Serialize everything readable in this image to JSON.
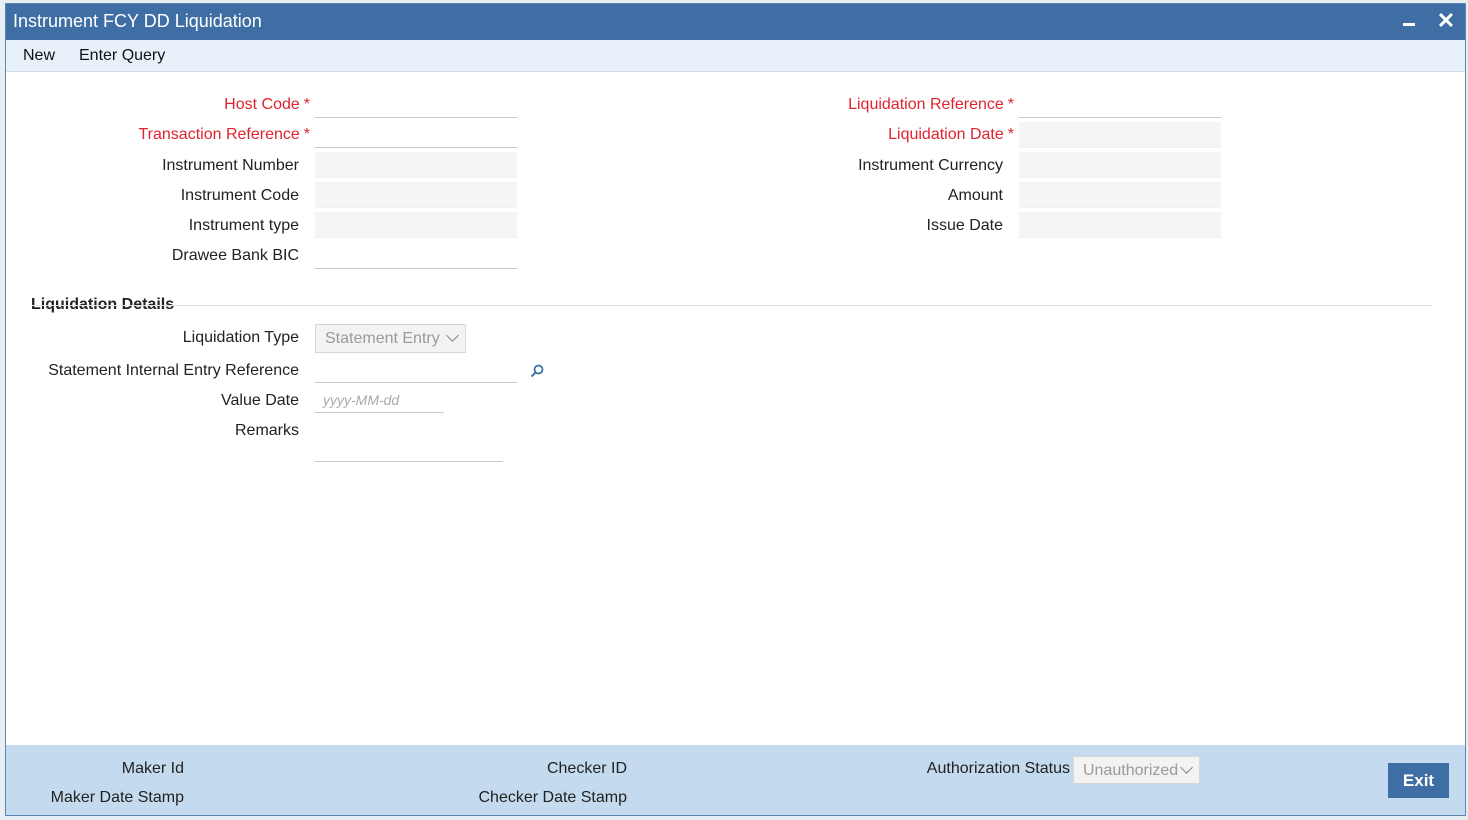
{
  "window": {
    "title": "Instrument FCY DD Liquidation",
    "minimize_glyph": "−",
    "close_glyph": "✕"
  },
  "menu": {
    "new": "New",
    "enter_query": "Enter Query"
  },
  "form": {
    "host_code": "Host Code",
    "transaction_reference": "Transaction Reference",
    "instrument_number": "Instrument Number",
    "instrument_code": "Instrument Code",
    "instrument_type": "Instrument type",
    "drawee_bank_bic": "Drawee Bank BIC",
    "liquidation_reference": "Liquidation Reference",
    "liquidation_date": "Liquidation Date",
    "instrument_currency": "Instrument Currency",
    "amount": "Amount",
    "issue_date": "Issue Date",
    "required_marker": "*"
  },
  "liquidation_details": {
    "section_title": "Liquidation Details",
    "liquidation_type_label": "Liquidation Type",
    "liquidation_type_value": "Statement Entry",
    "statement_ref_label": "Statement Internal Entry Reference",
    "value_date_label": "Value Date",
    "value_date_placeholder": "yyyy-MM-dd",
    "remarks_label": "Remarks"
  },
  "footer": {
    "maker_id": "Maker Id",
    "maker_date_stamp": "Maker Date Stamp",
    "checker_id": "Checker ID",
    "checker_date_stamp": "Checker Date Stamp",
    "authorization_status_label": "Authorization Status",
    "authorization_status_value": "Unauthorized",
    "exit": "Exit"
  },
  "colors": {
    "title_bar": "#3f6ea4",
    "required": "#e0232e",
    "footer": "#c4daee"
  }
}
